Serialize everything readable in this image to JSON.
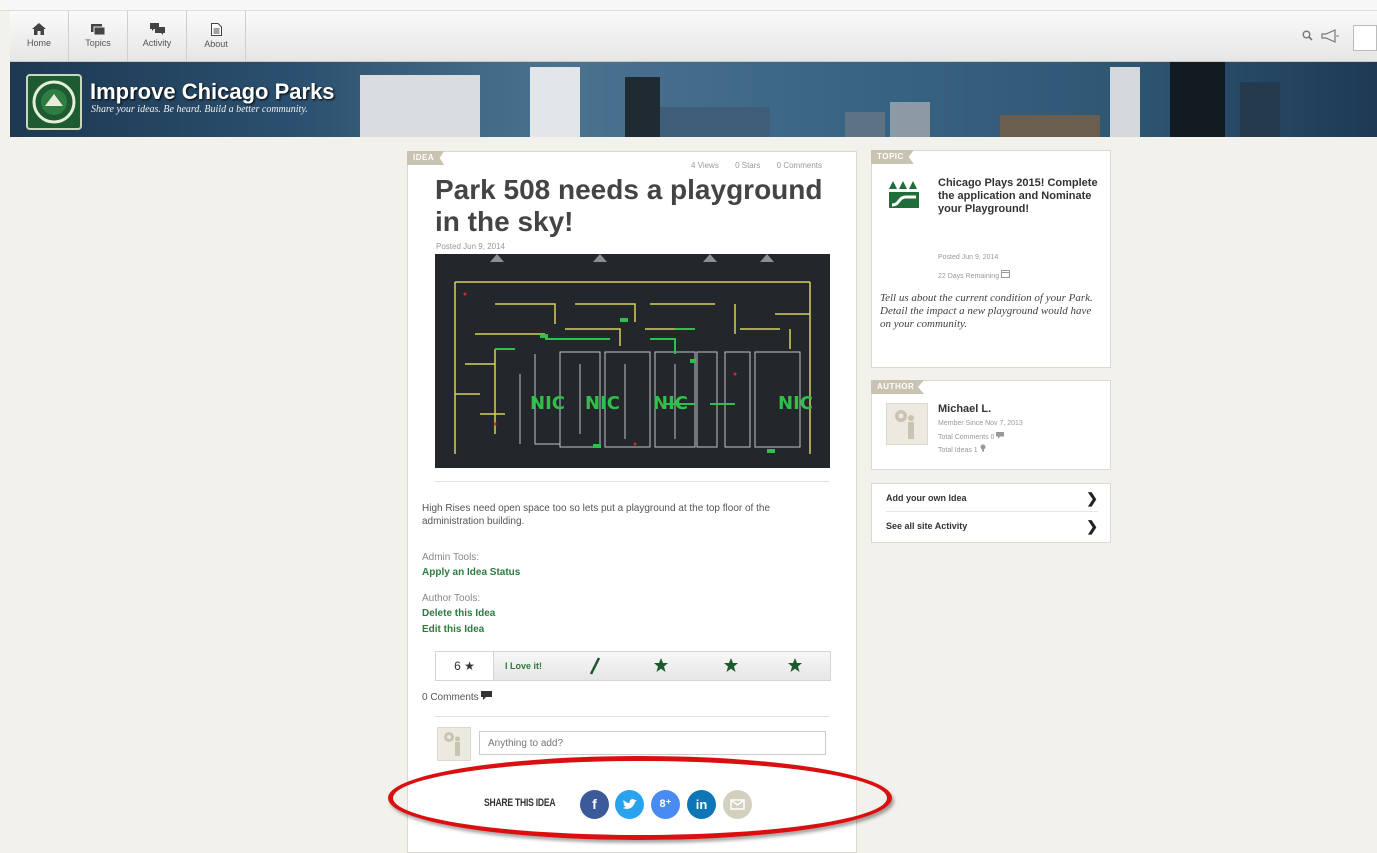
{
  "nav": {
    "home": "Home",
    "topics": "Topics",
    "activity": "Activity",
    "about": "About"
  },
  "header": {
    "title": "Improve Chicago Parks",
    "tagline": "Share your ideas. Be heard. Build a better community."
  },
  "idea": {
    "tag": "IDEA",
    "views": "4 Views",
    "stars": "0 Stars",
    "comments_stat": "0 Comments",
    "title": "Park 508 needs a playground in the sky!",
    "posted": "Posted Jun 9, 2014",
    "description": "High Rises need open space too so lets put a playground at the top floor of the administration building.",
    "admin_tools_label": "Admin Tools:",
    "admin_link": "Apply an Idea Status",
    "author_tools_label": "Author Tools:",
    "delete_link": "Delete this Idea",
    "edit_link": "Edit this Idea",
    "rating_count": "6",
    "love_label": "I Love it!",
    "comments_count": "0 Comments",
    "comment_placeholder": "Anything to add?",
    "plan_labels": [
      "NIC",
      "NIC",
      "NIC",
      "NIC"
    ]
  },
  "share": {
    "label": "SHARE THIS IDEA",
    "facebook": "f",
    "google": "8⁺",
    "linkedin": "in",
    "icons": [
      "facebook-icon",
      "twitter-icon",
      "google-plus-icon",
      "linkedin-icon",
      "email-icon"
    ],
    "colors": [
      "#3c5a99",
      "#2aa3ef",
      "#4a8bf3",
      "#0e76b7",
      "#d4d0bf"
    ]
  },
  "topic": {
    "tag": "TOPIC",
    "title": "Chicago Plays 2015! Complete the application and Nominate your Playground!",
    "posted": "Posted Jun 9, 2014",
    "remaining": "22 Days Remaining",
    "description": "Tell us about the current condition of your Park. Detail the impact a new playground would have on your community."
  },
  "author": {
    "tag": "AUTHOR",
    "name": "Michael L.",
    "member_since": "Member Since Nov 7, 2013",
    "total_comments": "Total Comments 0",
    "total_ideas": "Total Ideas 1"
  },
  "links": {
    "add_idea": "Add your own Idea",
    "see_activity": "See all site Activity"
  },
  "colors": {
    "accent_green": "#2d7a40",
    "highlight_red": "#d9100f"
  }
}
